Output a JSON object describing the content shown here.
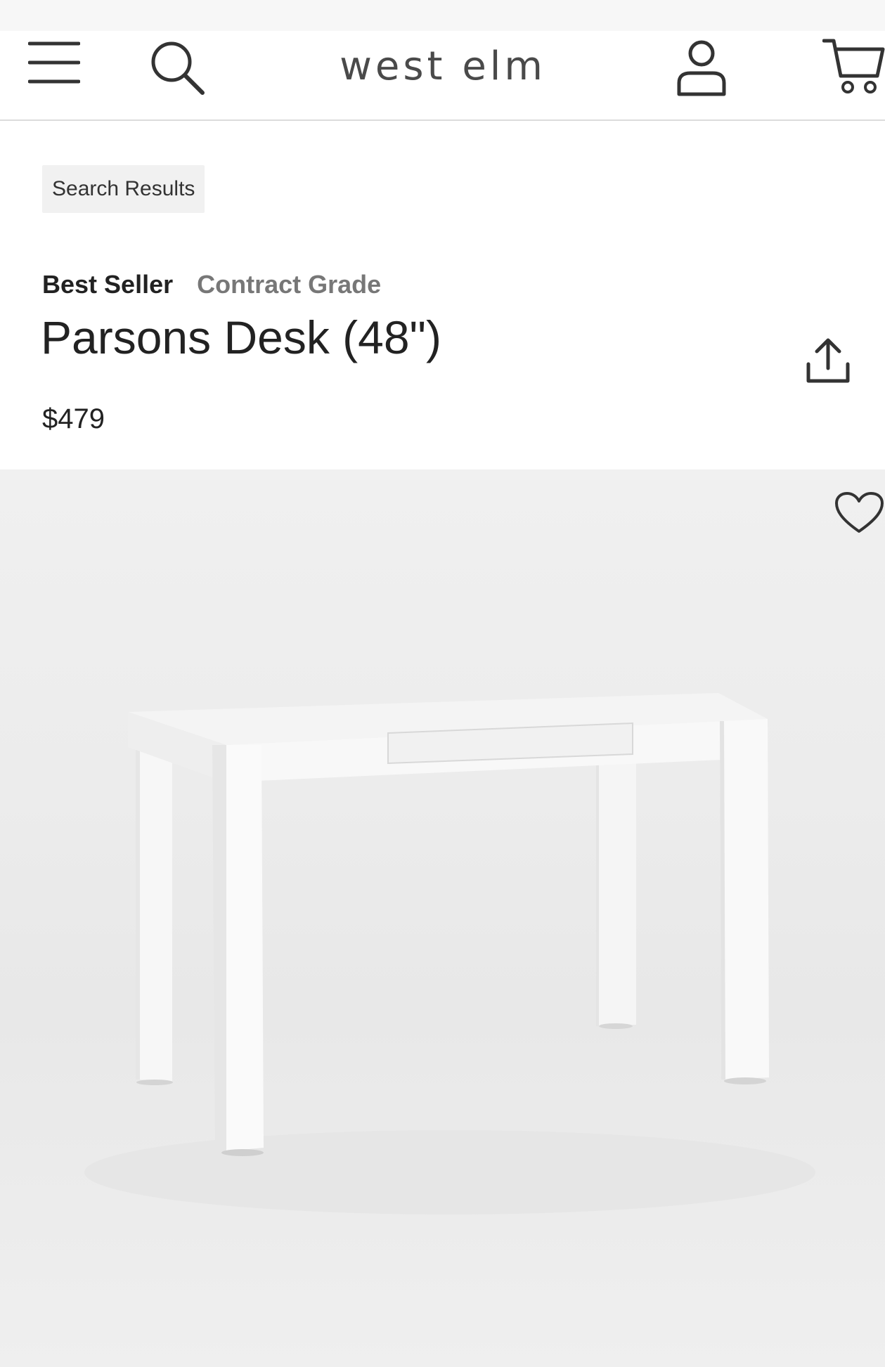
{
  "header": {
    "logo_text": "west elm",
    "icons": [
      "menu-icon",
      "search-icon",
      "account-icon",
      "cart-icon"
    ]
  },
  "breadcrumb": {
    "label": "Search Results"
  },
  "product": {
    "badges": {
      "best_seller": "Best Seller",
      "contract_grade": "Contract Grade"
    },
    "title": "Parsons Desk (48\")",
    "price": "$479",
    "image_icons": [
      "heart-icon",
      "share-icon"
    ]
  },
  "colors": {
    "text_primary": "#222222",
    "text_secondary": "#777777",
    "logo": "#4a4a4a",
    "chip_bg": "#f1f1f1",
    "hero_bg": "#ececec"
  }
}
